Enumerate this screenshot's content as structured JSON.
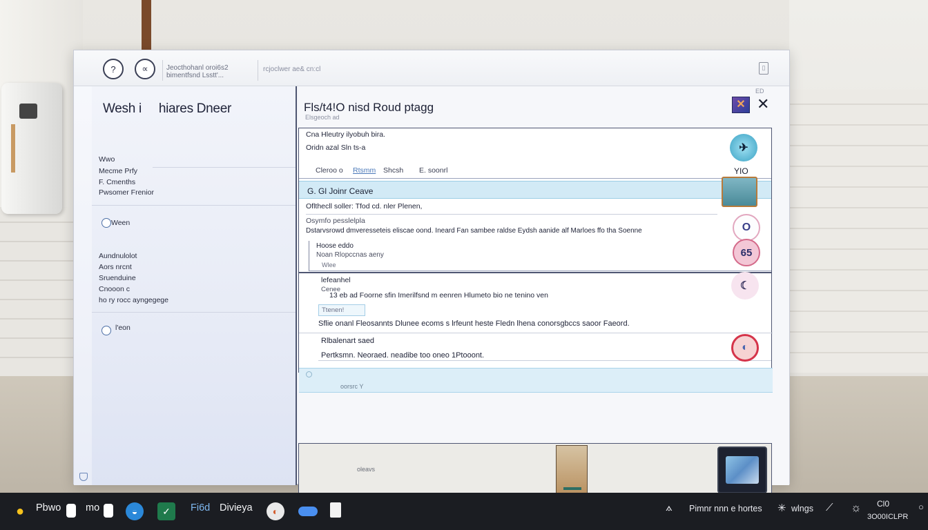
{
  "titlebar": {
    "icon1": "?",
    "icon2": "∝",
    "breadcrumb1": "Jeocthohanl oroi6s2",
    "breadcrumb1_line2": "bimentfsnd Lsstt'...",
    "breadcrumb2": "rcjoclwer ae& cn:cl",
    "doc_icon": "▯"
  },
  "sidebar": {
    "title": "Wesh i     hiares Dneer",
    "group1": [
      "Wwo",
      "Mecme Prfy",
      "F. Cmenths",
      "Pwsomer Frenior"
    ],
    "radio1": "Ween",
    "group2": [
      "Aundnulolot",
      "Aors nrcnt",
      "Sruenduine",
      "Cnooon c",
      "ho ry rocc ayngegege"
    ],
    "radio2": "l'eon"
  },
  "content": {
    "title": "Fls/t4!O nisd Roud ptagg",
    "subtitle": "Elsgeoch ad",
    "tiny": "ED",
    "close": "✕",
    "app_icon": "✕",
    "row1": "Cna Hleutry  ilyobuh bira.",
    "row2": "Oridn azal Sln ts-a",
    "filter": [
      "Cleroo o",
      "Rtsmm",
      "Shcsh",
      "E. soonrl"
    ],
    "filter_count": "YIO",
    "section_head": "G. Gl Joinr Ceave",
    "sec_row1": "Oflthecll soller: Tfod cd. nler Plenen,",
    "sec_row2": "Osymfo pesslelpla",
    "sec_row3": "Dstarvsrowd dmveresseteis eliscae oond. Ineard Fan sambee raldse Eydsh aanide alf Marloes ffo tha Soenne",
    "box_row1": "Hoose eddo",
    "box_row2": "Noan Rlopccnas aeny",
    "box_row3": "Wlee",
    "sub_head": "lefeanhel",
    "sub_row1": "Cenee",
    "sub_row2": "13  eb   ad Foorne sfin Imerilfsnd m eenren Hlumeto bio ne tenino  ven",
    "note": "Ttenen!",
    "para": "Sflie onanl Fleosannts Dlunee ecoms s lrfeunt heste Fledn lhena conorsgbccs saoor Faeord.",
    "para_head": "Rlbalenart saed",
    "para_row": "Pertksmn. Neoraed. neadibe too oneo 1Ptooont.",
    "footer_label": "oorsrc  Y",
    "bottom_label": "oleavs"
  },
  "taskbar": {
    "app1": "Pbwo",
    "app2": "mo",
    "app3": "Fi6d",
    "app4": "Divieya",
    "tray1": "Pimnr  nnn e hortes",
    "tray2": "wlngs",
    "clock1": "Cl0",
    "clock2": "3O00ICLPR"
  },
  "colors": {
    "accent": "#4d6fa6",
    "section_bg": "#d2eaf6",
    "taskbar": "#1b1d22",
    "border": "#4e5672"
  }
}
